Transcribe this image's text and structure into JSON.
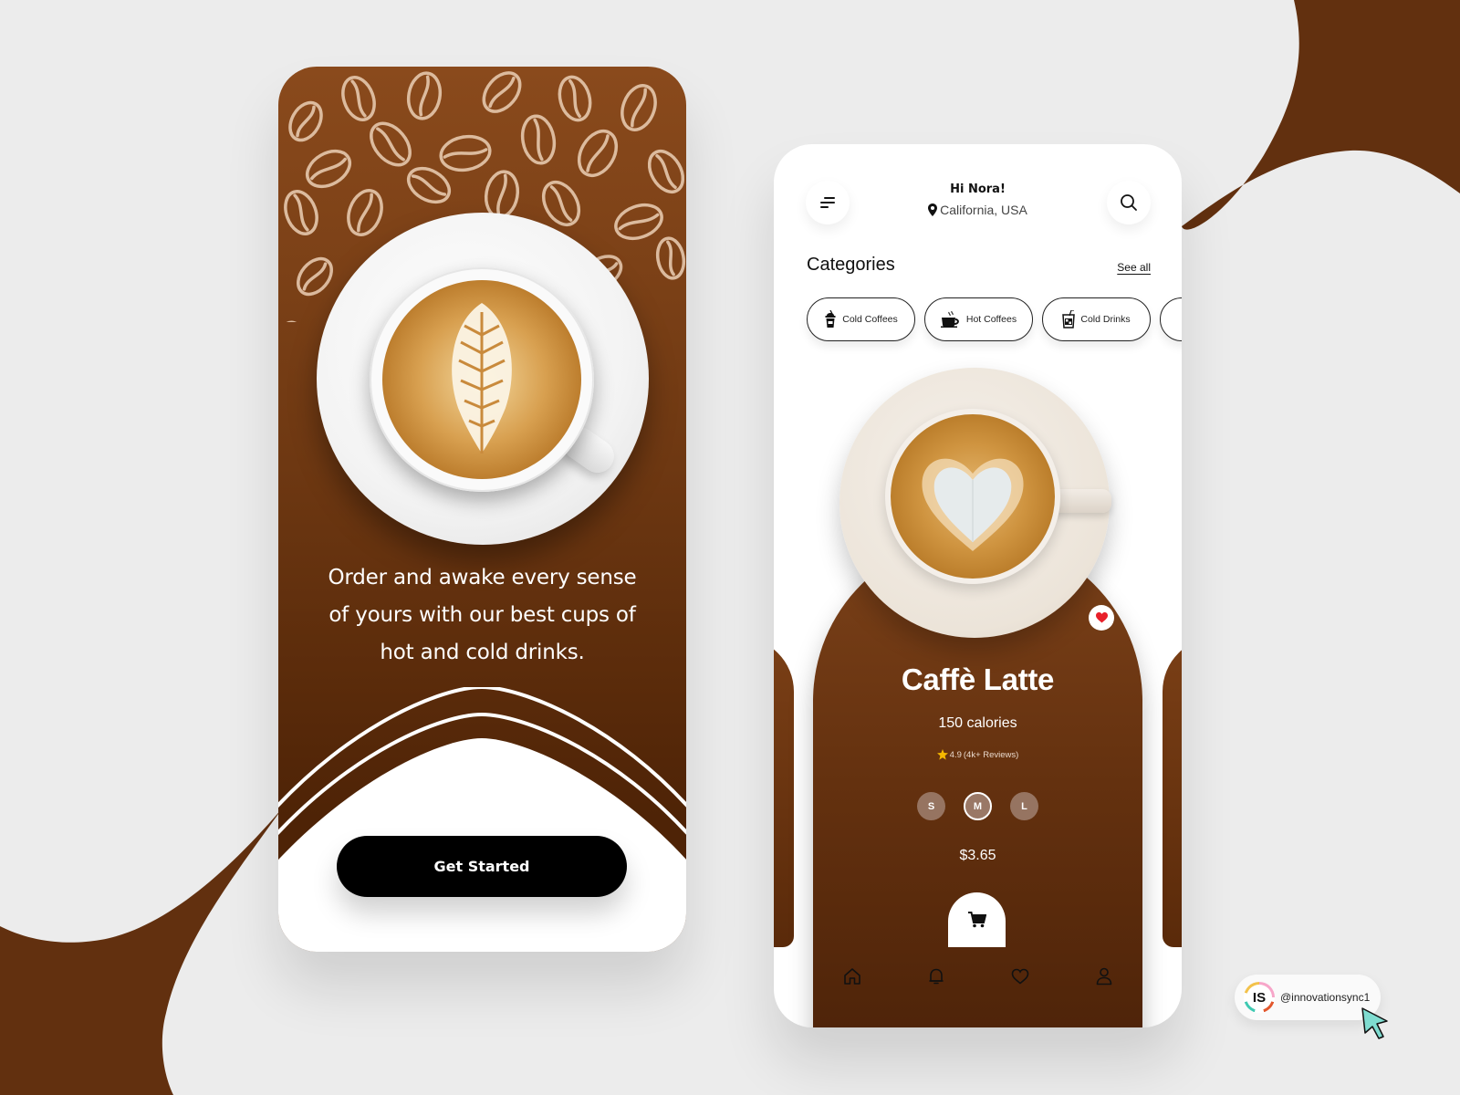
{
  "colors": {
    "brand_brown": "#62300f",
    "card_brown_top": "#7b4119",
    "card_brown_bottom": "#4a2108",
    "background": "#ececec",
    "button_black": "#000000",
    "heart_red": "#e8202a",
    "star_yellow": "#f5b800",
    "size_chip": "#967461"
  },
  "onboarding": {
    "tagline": "Order and awake every sense of yours with our best cups of hot and cold drinks.",
    "tagline_lines": [
      "Order and awake every sense",
      "of yours with our best cups of",
      "hot and cold drinks."
    ],
    "cta_label": "Get Started"
  },
  "home": {
    "header": {
      "menu_icon": "menu-lines-icon",
      "greeting": "Hi Nora!",
      "location_icon": "map-pin-icon",
      "location": "California, USA",
      "search_icon": "search-icon"
    },
    "categories": {
      "title": "Categories",
      "see_all_label": "See all",
      "items": [
        {
          "label": "Cold Coffees",
          "icon": "cold-coffee-icon"
        },
        {
          "label": "Hot Coffees",
          "icon": "hot-coffee-icon"
        },
        {
          "label": "Cold Drinks",
          "icon": "cold-drink-icon"
        },
        {
          "label": "",
          "icon": "cup-icon"
        }
      ]
    },
    "product": {
      "name": "Caffè Latte",
      "calories": "150 calories",
      "rating": "4.9",
      "reviews": "(4k+ Reviews)",
      "favorite": true,
      "sizes": [
        {
          "label": "S",
          "selected": false
        },
        {
          "label": "M",
          "selected": true
        },
        {
          "label": "L",
          "selected": false
        }
      ],
      "price": "$3.65",
      "cart_icon": "cart-icon"
    },
    "bottom_nav": [
      {
        "name": "home",
        "icon": "home-icon"
      },
      {
        "name": "notifications",
        "icon": "bell-icon"
      },
      {
        "name": "favorites",
        "icon": "heart-icon"
      },
      {
        "name": "profile",
        "icon": "user-icon"
      }
    ]
  },
  "watermark": {
    "logo_text": "IS",
    "handle": "@innovationsync1"
  }
}
